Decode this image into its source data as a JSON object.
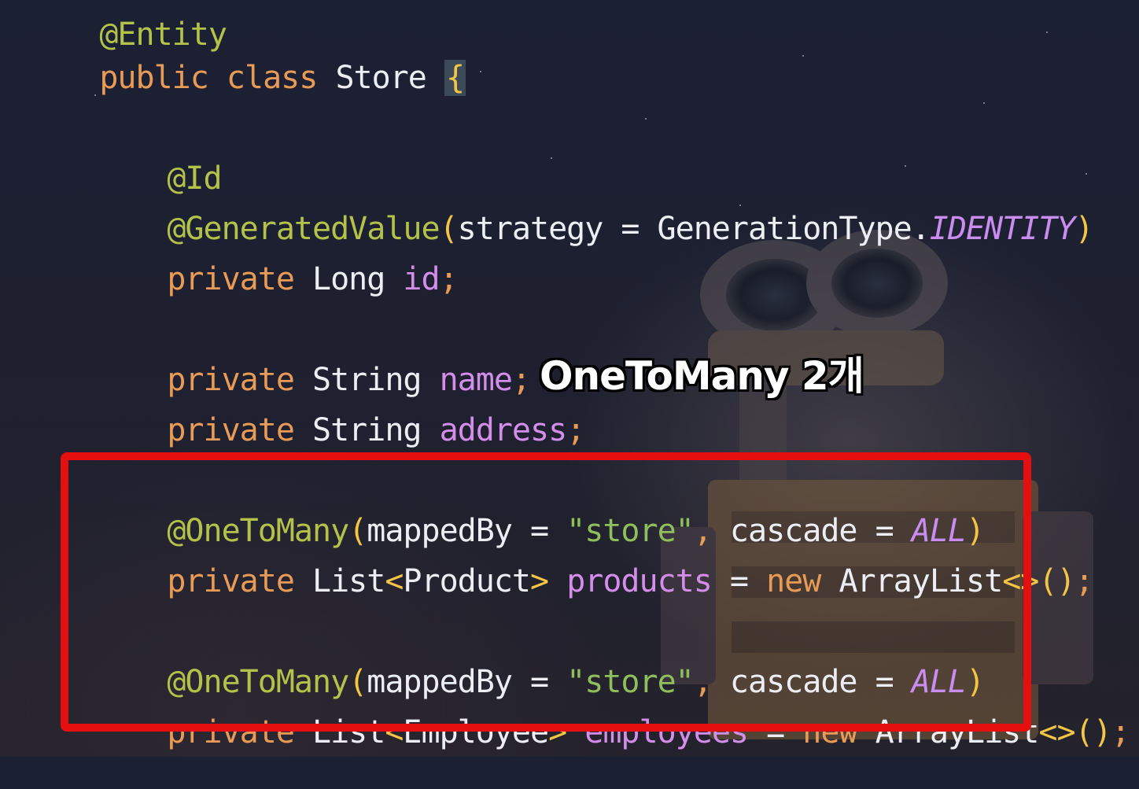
{
  "code": {
    "top_partial": "@Entity",
    "class_decl": {
      "kw1": "public",
      "kw2": "class",
      "name": "Store",
      "brace": "{"
    },
    "id_field": {
      "ann_id": "@Id",
      "ann_gen": "@GeneratedValue",
      "gen_open": "(",
      "gen_arg": "strategy = GenerationType.",
      "gen_const": "IDENTITY",
      "gen_close": ")",
      "kw": "private",
      "type": "Long",
      "name": "id",
      "semi": ";"
    },
    "name_field": {
      "kw": "private",
      "type": "String",
      "name": "name",
      "semi": ";"
    },
    "address_field": {
      "kw": "private",
      "type": "String",
      "name": "address",
      "semi": ";"
    },
    "products": {
      "ann": "@OneToMany",
      "open": "(",
      "arg1": "mappedBy = ",
      "str": "\"store\"",
      "comma": ",",
      "arg2": " cascade = ",
      "const": "ALL",
      "close": ")",
      "kw": "private",
      "type_pre": "List",
      "lt": "<",
      "type_arg": "Product",
      "gt": ">",
      "name": "products",
      "eq": " = ",
      "kw_new": "new",
      "ctor": "ArrayList",
      "diamond": "<>",
      "parens": "()",
      "semi": ";"
    },
    "employees": {
      "ann": "@OneToMany",
      "open": "(",
      "arg1": "mappedBy = ",
      "str": "\"store\"",
      "comma": ",",
      "arg2": " cascade = ",
      "const": "ALL",
      "close": ")",
      "kw": "private",
      "type_pre": "List",
      "lt": "<",
      "type_arg": "Employee",
      "gt": ">",
      "name": "employees",
      "eq": " = ",
      "kw_new": "new",
      "ctor": "ArrayList",
      "diamond": "<>",
      "parens": "()",
      "semi": ";"
    }
  },
  "annotation": {
    "label": "OneToMany 2개"
  },
  "colors": {
    "keyword": "#e79b56",
    "annotation": "#b3c34a",
    "field": "#d38ee9",
    "string": "#8fbf5c",
    "highlight_border": "#e50f0f"
  }
}
